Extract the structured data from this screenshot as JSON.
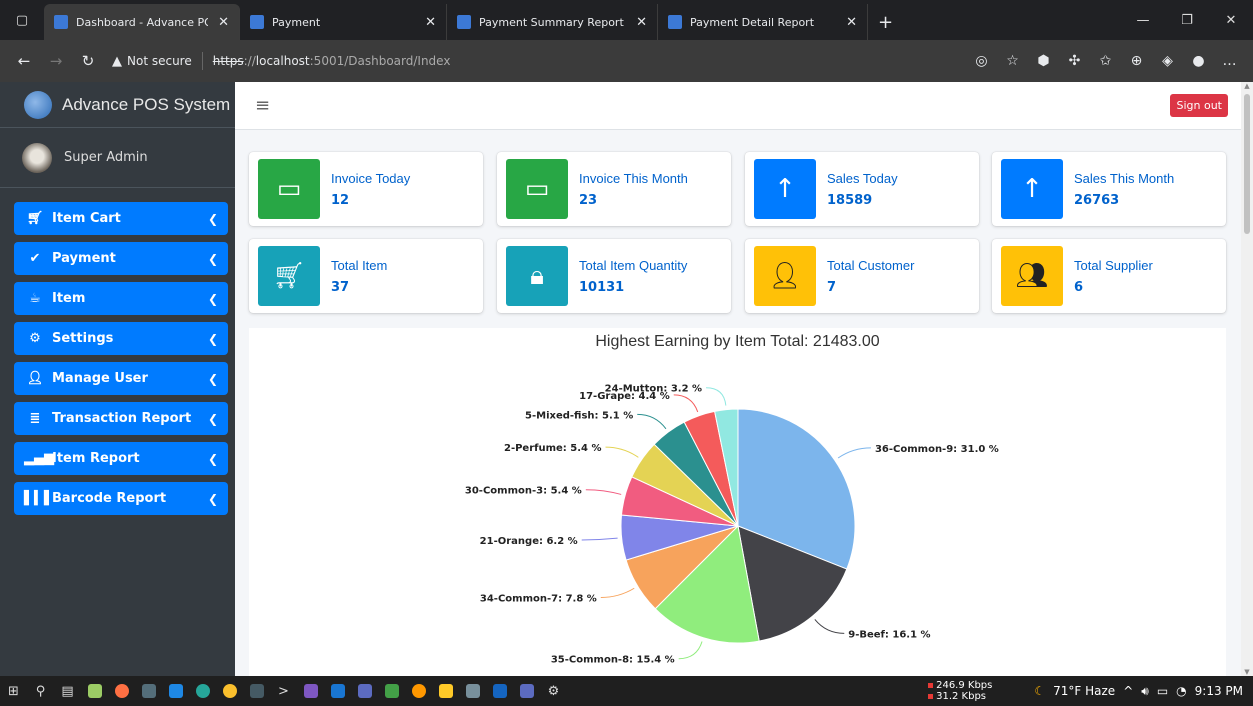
{
  "browser": {
    "tabs": [
      {
        "title": "Dashboard - Advance POS Syste",
        "active": true
      },
      {
        "title": "Payment",
        "active": false
      },
      {
        "title": "Payment Summary Report",
        "active": false
      },
      {
        "title": "Payment Detail Report",
        "active": false
      }
    ],
    "security_label": "Not secure",
    "url_scheme": "https",
    "url_sep": "://",
    "url_host": "localhost",
    "url_rest": ":5001/Dashboard/Index"
  },
  "app": {
    "brand": "Advance POS System",
    "user": "Super Admin",
    "signout": "Sign out"
  },
  "sidebar": {
    "items": [
      {
        "label": "Item Cart",
        "icon": "cart-icon"
      },
      {
        "label": "Payment",
        "icon": "check-circle-icon"
      },
      {
        "label": "Item",
        "icon": "mug-icon"
      },
      {
        "label": "Settings",
        "icon": "gears-icon"
      },
      {
        "label": "Manage User",
        "icon": "user-gear-icon"
      },
      {
        "label": "Transaction Report",
        "icon": "database-icon"
      },
      {
        "label": "Item Report",
        "icon": "signal-bars-icon"
      },
      {
        "label": "Barcode Report",
        "icon": "barcode-icon"
      }
    ]
  },
  "cards": [
    {
      "label": "Invoice Today",
      "value": "12",
      "color": "#28a745",
      "icon": "invoice-icon"
    },
    {
      "label": "Invoice This Month",
      "value": "23",
      "color": "#28a745",
      "icon": "invoice-icon"
    },
    {
      "label": "Sales Today",
      "value": "18589",
      "color": "#007bff",
      "icon": "arrow-up-icon"
    },
    {
      "label": "Sales This Month",
      "value": "26763",
      "color": "#007bff",
      "icon": "arrow-up-icon"
    },
    {
      "label": "Total Item",
      "value": "37",
      "color": "#17a2b8",
      "icon": "cart-icon"
    },
    {
      "label": "Total Item Quantity",
      "value": "10131",
      "color": "#17a2b8",
      "icon": "bag-icon"
    },
    {
      "label": "Total Customer",
      "value": "7",
      "color": "#ffc107",
      "icon": "user-check-icon"
    },
    {
      "label": "Total Supplier",
      "value": "6",
      "color": "#ffc107",
      "icon": "users-icon"
    }
  ],
  "chart_data": {
    "type": "pie",
    "title": "Highest Earning by Item Total: 21483.00",
    "slices": [
      {
        "label": "36-Common-9",
        "value": 31.0,
        "color": "#7cb5ec"
      },
      {
        "label": "9-Beef",
        "value": 16.1,
        "color": "#434348"
      },
      {
        "label": "35-Common-8",
        "value": 15.4,
        "color": "#90ed7d"
      },
      {
        "label": "34-Common-7",
        "value": 7.8,
        "color": "#f7a35c"
      },
      {
        "label": "21-Orange",
        "value": 6.2,
        "color": "#8085e9"
      },
      {
        "label": "30-Common-3",
        "value": 5.4,
        "color": "#f15c80"
      },
      {
        "label": "2-Perfume",
        "value": 5.4,
        "color": "#e4d354"
      },
      {
        "label": "5-Mixed-fish",
        "value": 5.1,
        "color": "#2b908f"
      },
      {
        "label": "17-Grape",
        "value": 4.4,
        "color": "#f45b5b"
      },
      {
        "label": "24-Mutton",
        "value": 3.2,
        "color": "#91e8e1"
      }
    ],
    "label_suffix": " %"
  },
  "taskbar": {
    "net_up": "246.9 Kbps",
    "net_down": "31.2 Kbps",
    "weather": "71°F  Haze",
    "time": "9:13 PM"
  }
}
